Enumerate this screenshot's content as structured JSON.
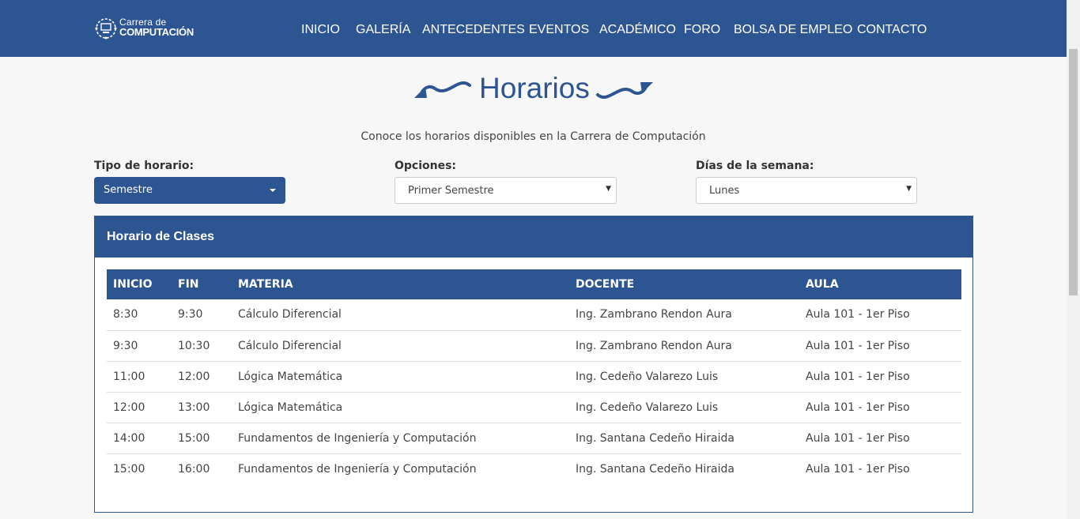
{
  "brand": {
    "line1": "Carrera de",
    "line2": "COMPUTACIÓN"
  },
  "nav": [
    {
      "label": "INICIO"
    },
    {
      "label": "GALERÍA"
    },
    {
      "label": "ANTECEDENTES"
    },
    {
      "label": "EVENTOS"
    },
    {
      "label": "ACADÉMICO"
    },
    {
      "label": "FORO"
    },
    {
      "label": "BOLSA DE EMPLEO"
    },
    {
      "label": "CONTACTO"
    }
  ],
  "page": {
    "title": "Horarios",
    "subtitle": "Conoce los horarios disponibles en la Carrera de Computación"
  },
  "filters": {
    "tipo": {
      "label": "Tipo de horario:",
      "value": "Semestre"
    },
    "opciones": {
      "label": "Opciones:",
      "value": "Primer Semestre"
    },
    "dias": {
      "label": "Días de la semana:",
      "value": "Lunes"
    }
  },
  "panel": {
    "title": "Horario de Clases",
    "columns": [
      "INICIO",
      "FIN",
      "MATERIA",
      "DOCENTE",
      "AULA"
    ],
    "rows": [
      [
        "8:30",
        "9:30",
        "Cálculo Diferencial",
        "Ing. Zambrano Rendon Aura",
        "Aula 101 - 1er Piso"
      ],
      [
        "9:30",
        "10:30",
        "Cálculo Diferencial",
        "Ing. Zambrano Rendon Aura",
        "Aula 101 - 1er Piso"
      ],
      [
        "11:00",
        "12:00",
        "Lógica Matemática",
        "Ing. Cedeño Valarezo Luis",
        "Aula 101 - 1er Piso"
      ],
      [
        "12:00",
        "13:00",
        "Lógica Matemática",
        "Ing. Cedeño Valarezo Luis",
        "Aula 101 - 1er Piso"
      ],
      [
        "14:00",
        "15:00",
        "Fundamentos de Ingeniería y Computación",
        "Ing. Santana Cedeño Hiraida",
        "Aula 101 - 1er Piso"
      ],
      [
        "15:00",
        "16:00",
        "Fundamentos de Ingeniería y Computación",
        "Ing. Santana Cedeño Hiraida",
        "Aula 101 - 1er Piso"
      ]
    ]
  },
  "colors": {
    "primary": "#2d5591",
    "background": "#f7f7f7"
  }
}
